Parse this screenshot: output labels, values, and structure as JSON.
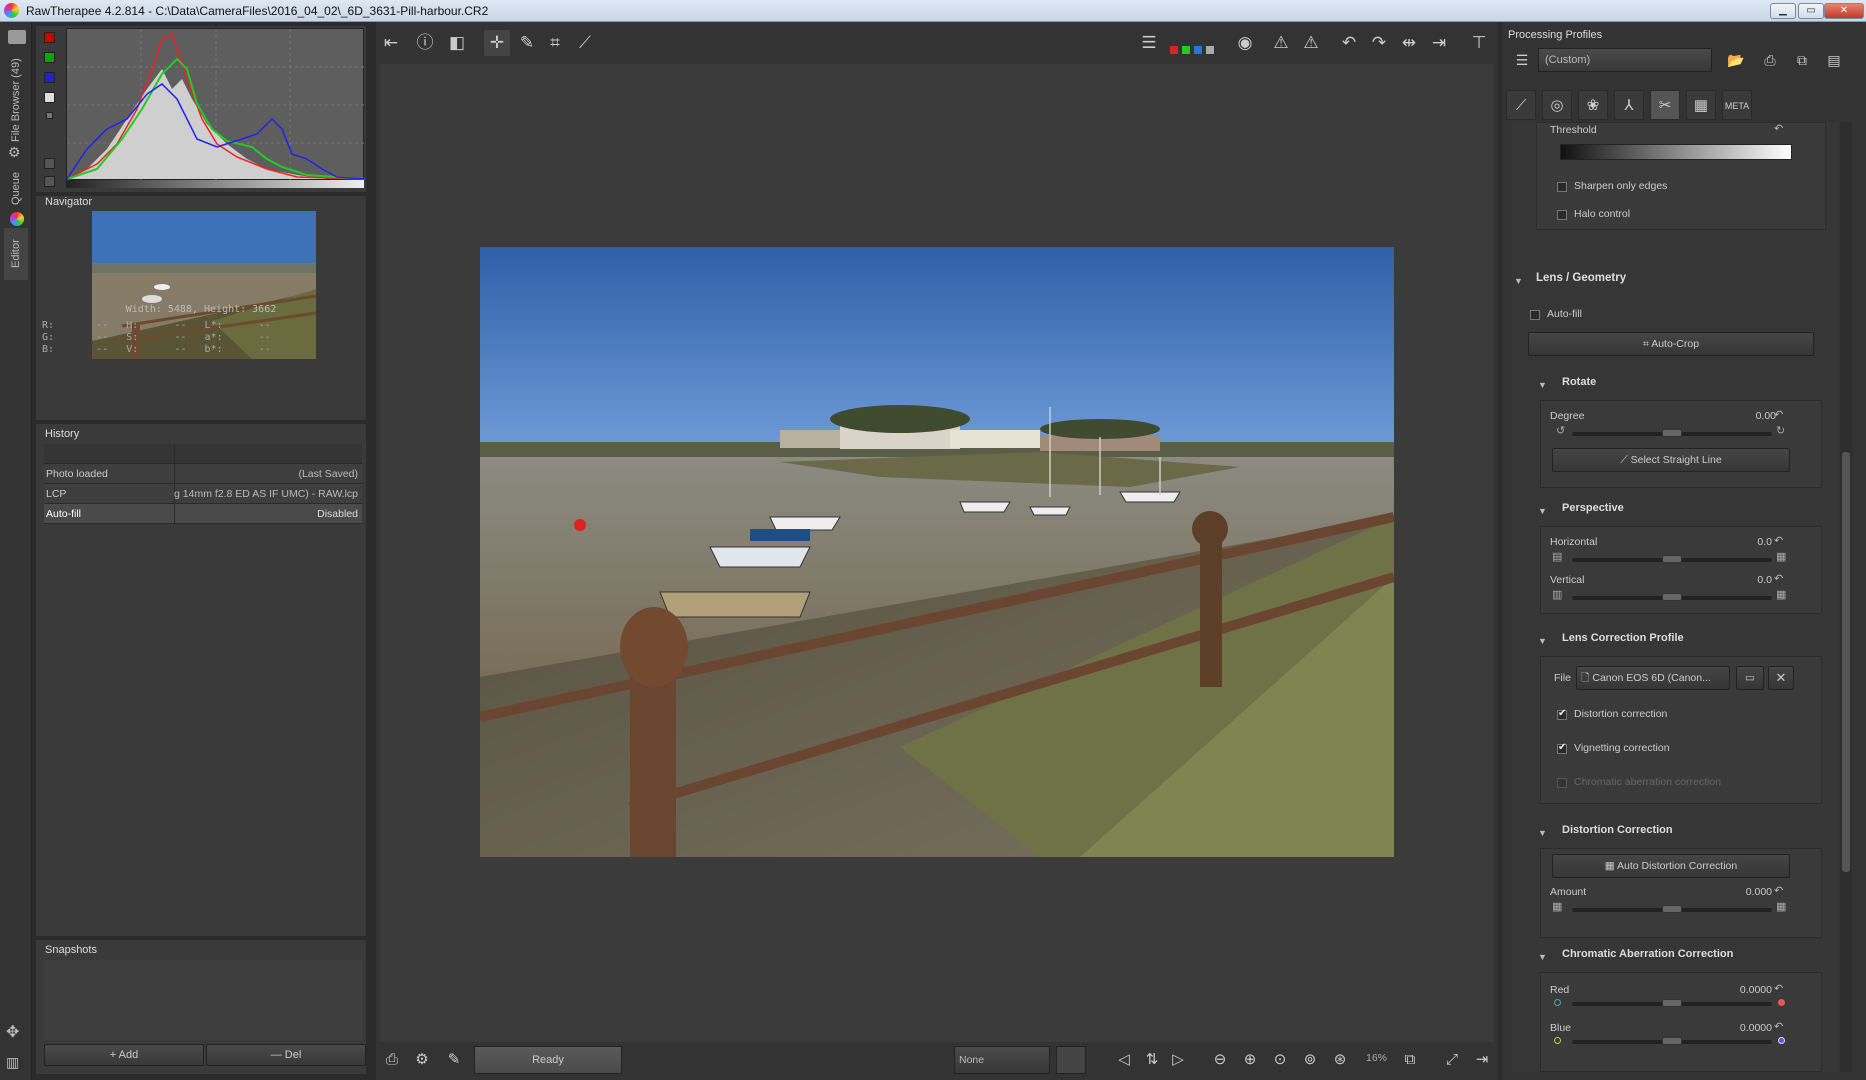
{
  "window": {
    "title": "RawTherapee 4.2.814 - C:\\Data\\CameraFiles\\2016_04_02\\_6D_3631-Pill-harbour.CR2",
    "buttons": {
      "minimize": "▁",
      "maximize": "▭",
      "close": "✕"
    }
  },
  "left_tabs": {
    "file_browser": "File Browser (49)",
    "queue": "Queue",
    "editor": "Editor"
  },
  "navigator": {
    "title": "Navigator",
    "dimensions": "Width: 5488, Height: 3662",
    "rows": [
      "R:       --   H:      --   L*:      --",
      "G:       --   S:      --   a*:      --",
      "B:       --   V:      --   b*:      --"
    ]
  },
  "history": {
    "title": "History",
    "items": [
      {
        "name": "Photo loaded",
        "value": "(Last Saved)"
      },
      {
        "name": "LCP",
        "value": "g 14mm f2.8 ED AS IF UMC) - RAW.lcp"
      },
      {
        "name": "Auto-fill",
        "value": "Disabled"
      }
    ]
  },
  "snapshots": {
    "title": "Snapshots",
    "add": "+ Add",
    "del": "— Del"
  },
  "status": {
    "ready": "Ready",
    "none_select": "None",
    "zoom": "16%"
  },
  "processing_profiles": {
    "title": "Processing Profiles",
    "selected": "(Custom)"
  },
  "tool_tabs": [
    "exposure",
    "detail",
    "color",
    "advanced",
    "transform",
    "raw",
    "META"
  ],
  "sharpening": {
    "threshold_label": "Threshold",
    "sharpen_only_edges": "Sharpen only edges",
    "halo_control": "Halo control"
  },
  "lens_geometry": {
    "title": "Lens / Geometry",
    "auto_fill": "Auto-fill",
    "auto_crop": "Auto-Crop",
    "rotate": {
      "title": "Rotate",
      "degree_label": "Degree",
      "degree_value": "0.00",
      "straight_line": "Select Straight Line"
    },
    "perspective": {
      "title": "Perspective",
      "horizontal_label": "Horizontal",
      "horizontal_value": "0.0",
      "vertical_label": "Vertical",
      "vertical_value": "0.0"
    },
    "lens_profile": {
      "title": "Lens Correction Profile",
      "file_label": "File",
      "file_value": "Canon EOS 6D (Canon...",
      "distortion": "Distortion correction",
      "vignetting": "Vignetting correction",
      "chromatic": "Chromatic aberration correction"
    },
    "distortion": {
      "title": "Distortion Correction",
      "auto_btn": "Auto Distortion Correction",
      "amount_label": "Amount",
      "amount_value": "0.000"
    },
    "ca": {
      "title": "Chromatic Aberration Correction",
      "red_label": "Red",
      "red_value": "0.0000",
      "blue_label": "Blue",
      "blue_value": "0.0000"
    }
  }
}
